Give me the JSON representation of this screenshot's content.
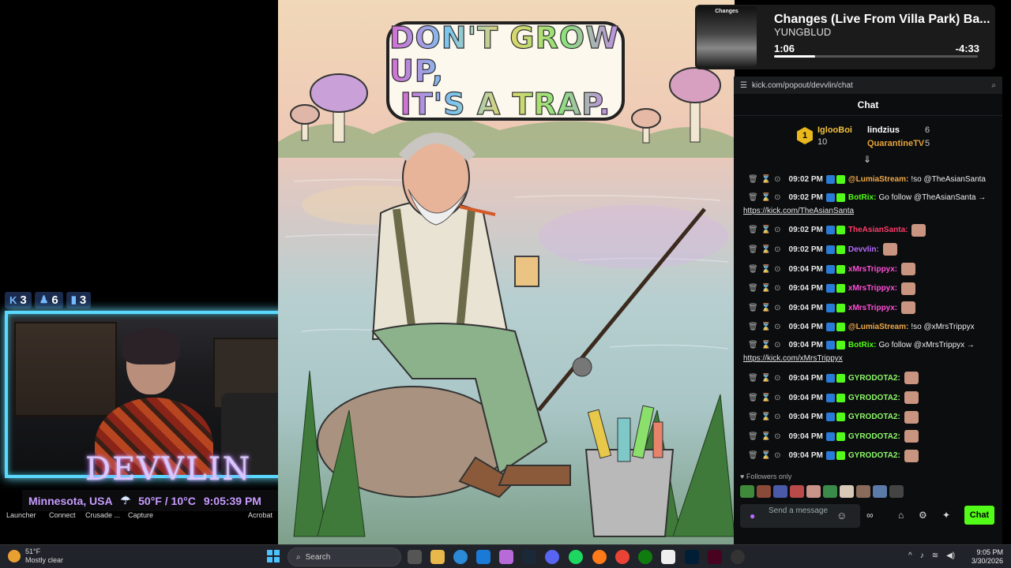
{
  "overlay": {
    "stats": [
      {
        "icon": "kick-icon",
        "value": "3"
      },
      {
        "icon": "person-icon",
        "value": "6"
      },
      {
        "icon": "bar-chart-icon",
        "value": "3"
      }
    ],
    "brand": "DEVVLIN",
    "location": "Minnesota, USA",
    "weather": "50°F / 10°C",
    "time": "9:05:39 PM",
    "launcher_labels": [
      "Launcher",
      "Connect",
      "Crusade ...",
      "Capture",
      "Acrobat"
    ]
  },
  "artwork": {
    "bubble_line1": "DON'T GROW UP,",
    "bubble_line2": "IT'S A TRAP."
  },
  "now_playing": {
    "thumb_label": "Changes",
    "title": "Changes (Live From Villa Park) Ba...",
    "artist": "YUNGBLUD",
    "elapsed": "1:06",
    "remaining": "-4:33",
    "progress": 0.2
  },
  "chat": {
    "url": "kick.com/popout/devvlin/chat",
    "header": "Chat",
    "leaderboard": {
      "first": {
        "rank": "1",
        "name": "IglooBoi",
        "count": "10"
      },
      "others": [
        {
          "name": "lindzius",
          "count": "6"
        },
        {
          "name": "QuarantineTV",
          "count": "5"
        }
      ]
    },
    "messages": [
      {
        "time": "09:02 PM",
        "user": "@LumiaStream:",
        "user_color": "#f0a94a",
        "text": "!so @TheAsianSanta",
        "link": ""
      },
      {
        "time": "09:02 PM",
        "user": "BotRix:",
        "user_color": "#53fc18",
        "text": "Go follow @TheAsianSanta →",
        "link": "https://kick.com/TheAsianSanta"
      },
      {
        "time": "09:02 PM",
        "user": "TheAsianSanta:",
        "user_color": "#ff3b6b",
        "text": "",
        "link": ""
      },
      {
        "time": "09:02 PM",
        "user": "Devvlin:",
        "user_color": "#b46bff",
        "text": "",
        "link": ""
      },
      {
        "time": "09:04 PM",
        "user": "xMrsTrippyx:",
        "user_color": "#ff4fd8",
        "text": "",
        "link": ""
      },
      {
        "time": "09:04 PM",
        "user": "xMrsTrippyx:",
        "user_color": "#ff4fd8",
        "text": "",
        "link": ""
      },
      {
        "time": "09:04 PM",
        "user": "xMrsTrippyx:",
        "user_color": "#ff4fd8",
        "text": "",
        "link": ""
      },
      {
        "time": "09:04 PM",
        "user": "@LumiaStream:",
        "user_color": "#f0a94a",
        "text": "!so @xMrsTrippyx",
        "link": ""
      },
      {
        "time": "09:04 PM",
        "user": "BotRix:",
        "user_color": "#53fc18",
        "text": "Go follow @xMrsTrippyx →",
        "link": "https://kick.com/xMrsTrippyx"
      },
      {
        "time": "09:04 PM",
        "user": "GYRODOTA2:",
        "user_color": "#8ef86a",
        "text": "",
        "link": ""
      },
      {
        "time": "09:04 PM",
        "user": "GYRODOTA2:",
        "user_color": "#8ef86a",
        "text": "",
        "link": ""
      },
      {
        "time": "09:04 PM",
        "user": "GYRODOTA2:",
        "user_color": "#8ef86a",
        "text": "",
        "link": ""
      },
      {
        "time": "09:04 PM",
        "user": "GYRODOTA2:",
        "user_color": "#8ef86a",
        "text": "",
        "link": ""
      },
      {
        "time": "09:04 PM",
        "user": "GYRODOTA2:",
        "user_color": "#8ef86a",
        "text": "",
        "link": ""
      }
    ],
    "followers_only": "Followers only",
    "input_placeholder": "Send a message",
    "send_label": "Chat",
    "accent": "#53fc18"
  },
  "taskbar": {
    "temp": "51°F",
    "condition": "Mostly clear",
    "search_placeholder": "Search",
    "time": "9:05 PM",
    "date": "3/30/2026"
  }
}
